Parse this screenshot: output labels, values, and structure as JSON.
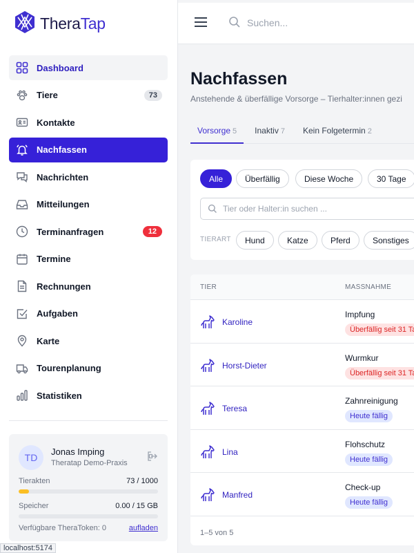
{
  "app": {
    "name_part1": "Thera",
    "name_part2": "Tap",
    "brand_color": "#3621d8"
  },
  "topbar": {
    "search_placeholder": "Suchen..."
  },
  "sidebar": {
    "items": [
      {
        "label": "Dashboard",
        "icon": "grid-icon"
      },
      {
        "label": "Tiere",
        "icon": "paw-icon",
        "badge": "73"
      },
      {
        "label": "Kontakte",
        "icon": "contact-card-icon"
      },
      {
        "label": "Nachfassen",
        "icon": "bell-icon"
      },
      {
        "label": "Nachrichten",
        "icon": "chat-icon"
      },
      {
        "label": "Mitteilungen",
        "icon": "inbox-icon"
      },
      {
        "label": "Terminanfragen",
        "icon": "clock-icon",
        "badge": "12"
      },
      {
        "label": "Termine",
        "icon": "calendar-icon"
      },
      {
        "label": "Rechnungen",
        "icon": "document-icon"
      },
      {
        "label": "Aufgaben",
        "icon": "checkbox-icon"
      },
      {
        "label": "Karte",
        "icon": "map-pin-icon"
      },
      {
        "label": "Tourenplanung",
        "icon": "truck-icon"
      },
      {
        "label": "Statistiken",
        "icon": "bar-chart-icon"
      }
    ],
    "user": {
      "initials": "TD",
      "name": "Jonas Imping",
      "org": "Theratap Demo-Praxis",
      "tierakten_label": "Tierakten",
      "tierakten_value": "73 / 1000",
      "tierakten_fraction": 0.073,
      "speicher_label": "Speicher",
      "speicher_value": "0.00 / 15 GB",
      "speicher_fraction": 0,
      "token_label": "Verfügbare TheraToken: 0",
      "token_link": "aufladen"
    }
  },
  "status_url": "localhost:5174",
  "main": {
    "title": "Nachfassen",
    "subtitle": "Anstehende & überfällige Vorsorge – Tierhalter:innen gezi",
    "tabs": [
      {
        "label": "Vorsorge",
        "count": "5"
      },
      {
        "label": "Inaktiv",
        "count": "7"
      },
      {
        "label": "Kein Folgetermin",
        "count": "2"
      }
    ],
    "filters": {
      "period": [
        "Alle",
        "Überfällig",
        "Diese Woche",
        "30 Tage"
      ],
      "search_placeholder": "Tier oder Halter:in suchen ...",
      "species_label": "TIERART",
      "species": [
        "Hund",
        "Katze",
        "Pferd",
        "Sonstiges"
      ]
    },
    "table": {
      "headers": [
        "TIER",
        "MASSNAHME"
      ],
      "rows": [
        {
          "name": "Karoline",
          "measure": "Impfung",
          "status": "Überfällig seit 31 Ta",
          "status_type": "overdue"
        },
        {
          "name": "Horst-Dieter",
          "measure": "Wurmkur",
          "status": "Überfällig seit 31 Ta",
          "status_type": "overdue"
        },
        {
          "name": "Teresa",
          "measure": "Zahnreinigung",
          "status": "Heute fällig",
          "status_type": "today"
        },
        {
          "name": "Lina",
          "measure": "Flohschutz",
          "status": "Heute fällig",
          "status_type": "today"
        },
        {
          "name": "Manfred",
          "measure": "Check-up",
          "status": "Heute fällig",
          "status_type": "today"
        }
      ],
      "footer": "1–5 von 5"
    }
  }
}
